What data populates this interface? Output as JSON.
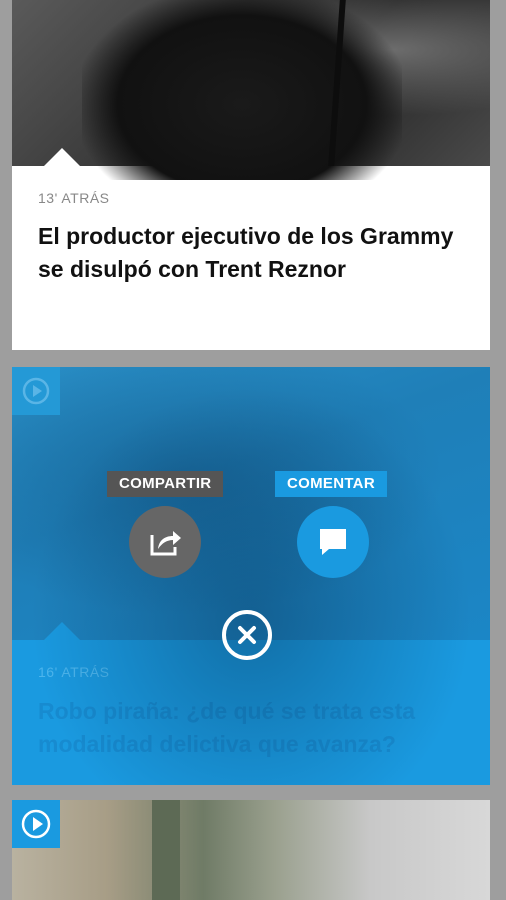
{
  "articles": [
    {
      "time_ago": "13' ATRÁS",
      "title": "El productor ejecutivo de los Grammy se disulpó con Trent Reznor"
    },
    {
      "time_ago": "16' ATRÁS",
      "title": "Robo piraña: ¿de qué se trata esta modalidad delictiva que avanza?"
    }
  ],
  "actions": {
    "share_label": "COMPARTIR",
    "comment_label": "COMENTAR"
  },
  "icons": {
    "share": "share-icon",
    "comment": "comment-icon",
    "close": "close-icon",
    "play": "play-icon"
  },
  "colors": {
    "accent": "#1a9ae0",
    "share_bg": "#666666",
    "page_bg": "#9e9e9e"
  }
}
